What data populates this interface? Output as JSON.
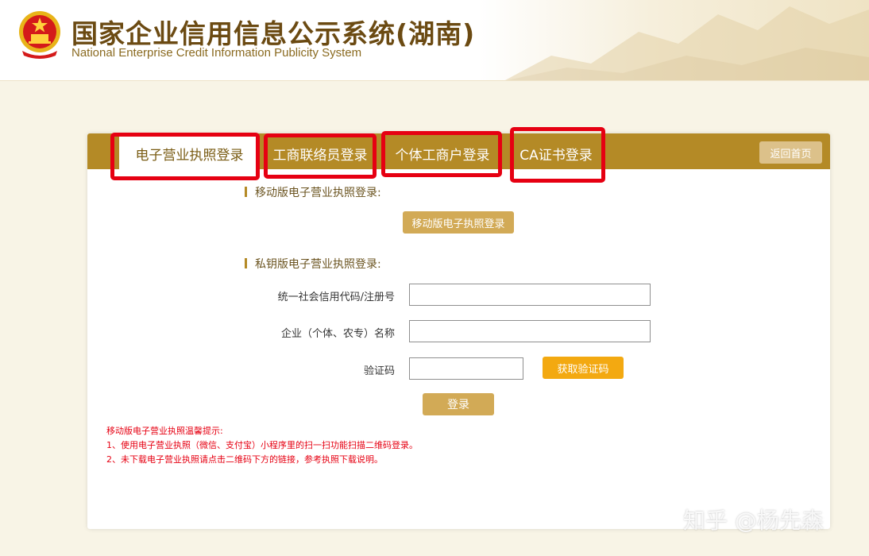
{
  "header": {
    "title_cn": "国家企业信用信息公示系统(湖南)",
    "title_en": "National Enterprise Credit Information Publicity System"
  },
  "tabs": [
    {
      "label": "电子营业执照登录",
      "active": true
    },
    {
      "label": "工商联络员登录",
      "active": false
    },
    {
      "label": "个体工商户登录",
      "active": false
    },
    {
      "label": "CA证书登录",
      "active": false
    }
  ],
  "home_button": "返回首页",
  "mobile_section": {
    "title": "移动版电子营业执照登录:",
    "button": "移动版电子执照登录"
  },
  "private_key_section": {
    "title": "私钥版电子营业执照登录:",
    "fields": [
      {
        "label": "统一社会信用代码/注册号",
        "value": ""
      },
      {
        "label": "企业（个体、农专）名称",
        "value": ""
      },
      {
        "label": "验证码",
        "value": ""
      }
    ],
    "captcha_button": "获取验证码",
    "login_button": "登录"
  },
  "notes": [
    "移动版电子营业执照温馨提示:",
    "1、使用电子营业执照（微信、支付宝）小程序里的扫一扫功能扫描二维码登录。",
    "2、未下载电子营业执照请点击二维码下方的链接，参考执照下载说明。"
  ],
  "watermark": "知乎 @杨先森",
  "colors": {
    "tab_bar": "#b48a26",
    "highlight": "#e60012",
    "captcha_button": "#f3a911",
    "gold_button": "#d2aa56"
  }
}
